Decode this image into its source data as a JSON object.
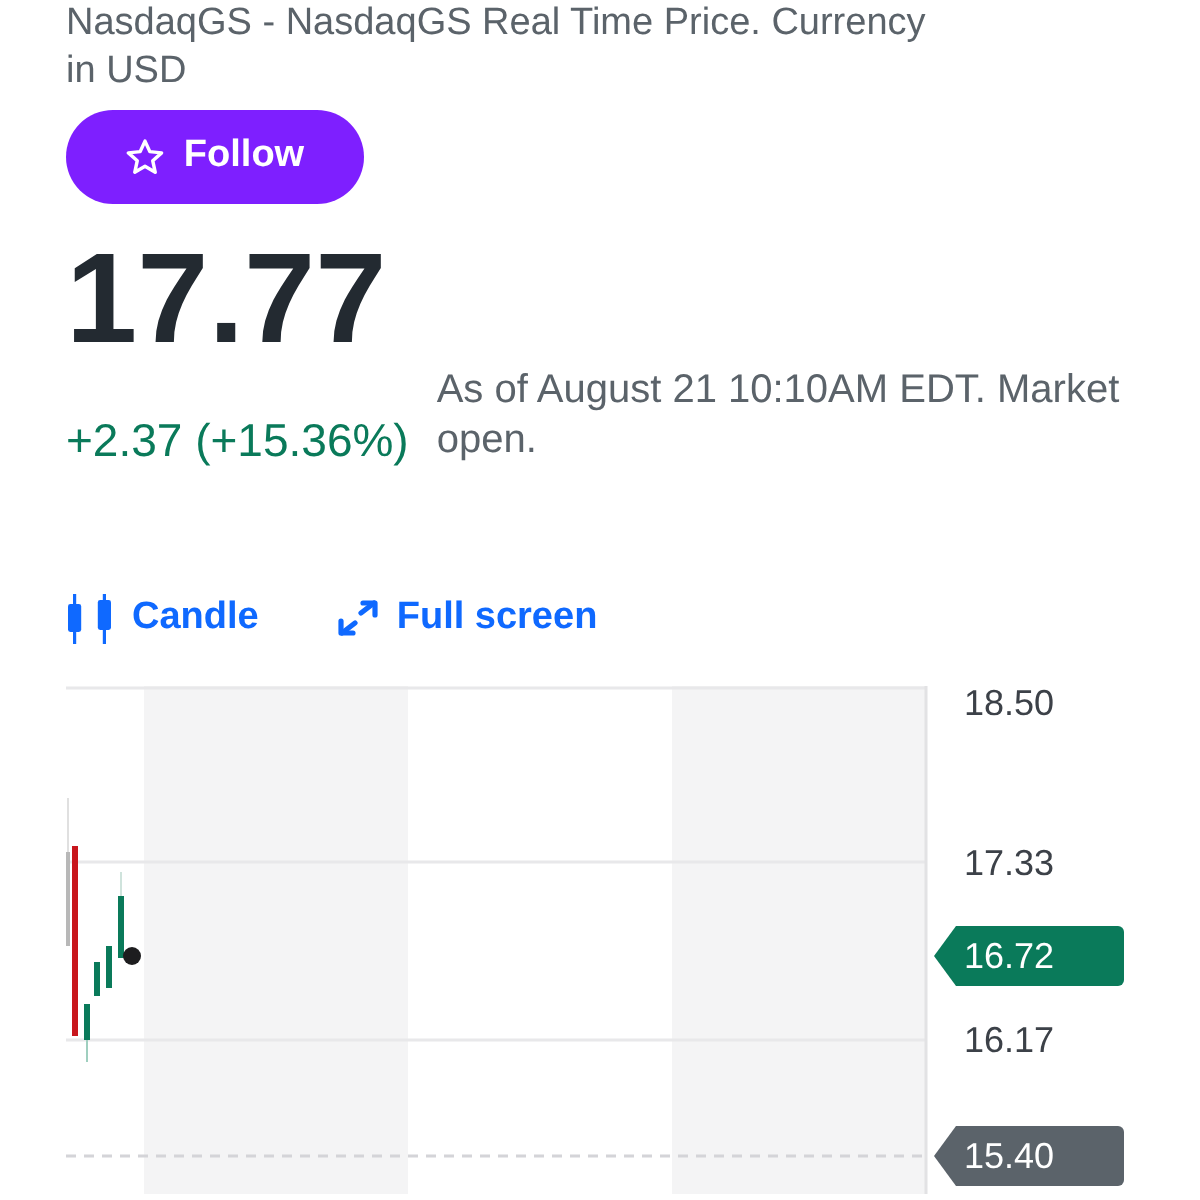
{
  "quote_header": {
    "exchange_note": "NasdaqGS - NasdaqGS Real Time Price. Currency in USD"
  },
  "follow_button": {
    "label": "Follow"
  },
  "price": {
    "value": "17.77",
    "change": "+2.37 (+15.36%)",
    "gain": true,
    "timestamp": "As of August 21 10:10AM EDT. Market open."
  },
  "chart_toolbar": [
    {
      "kind": "candle",
      "label": "Candle"
    },
    {
      "kind": "fullscreen",
      "label": "Full screen"
    }
  ],
  "chart": {
    "y_axis_labels": [
      "18.50",
      "17.33",
      "16.17"
    ],
    "price_tags": [
      {
        "kind": "last",
        "label": "16.72",
        "color": "#0a7a5a"
      },
      {
        "kind": "previous_close",
        "label": "15.40",
        "color": "#5b636a"
      }
    ]
  }
}
